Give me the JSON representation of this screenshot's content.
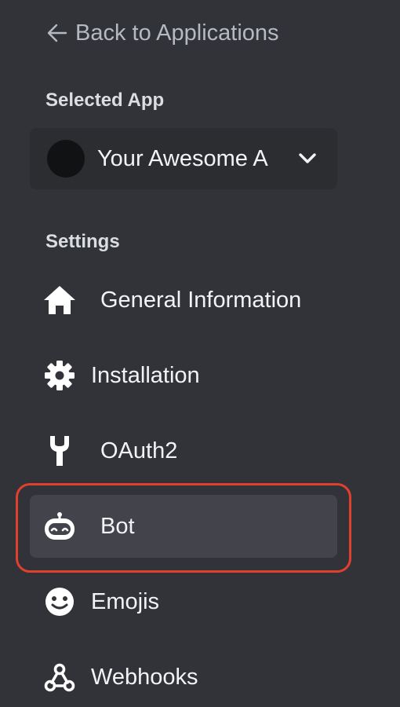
{
  "back_link": {
    "label": "Back to Applications"
  },
  "selected_app": {
    "section_label": "Selected App",
    "app_name": "Your Awesome A"
  },
  "settings": {
    "section_label": "Settings",
    "items": [
      {
        "label": "General Information",
        "icon": "home-icon"
      },
      {
        "label": "Installation",
        "icon": "gear-icon"
      },
      {
        "label": "OAuth2",
        "icon": "wrench-icon"
      },
      {
        "label": "Bot",
        "icon": "bot-icon",
        "active": true,
        "highlighted": true
      },
      {
        "label": "Emojis",
        "icon": "emoji-icon"
      },
      {
        "label": "Webhooks",
        "icon": "webhook-icon"
      }
    ]
  },
  "colors": {
    "background": "#323338",
    "active_item": "#43444b",
    "highlight_ring": "#e0402e",
    "text": "#f2f3f5"
  }
}
